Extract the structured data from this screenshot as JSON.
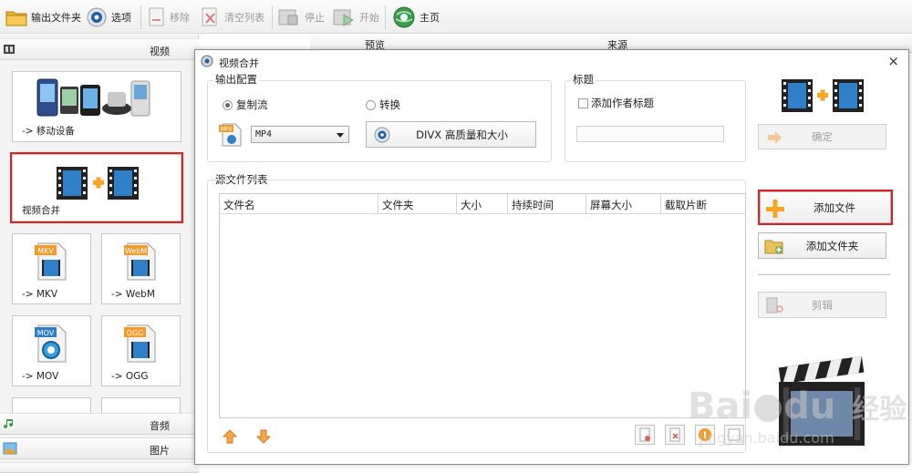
{
  "toolbar": {
    "output_folder": "输出文件夹",
    "options": "选项",
    "remove": "移除",
    "clear_list": "清空列表",
    "stop": "停止",
    "start": "开始",
    "home": "主页"
  },
  "left_panel": {
    "video_category": "视频",
    "tiles": {
      "mobile": "-> 移动设备",
      "merge": "视频合并",
      "mkv": "-> MKV",
      "webm": "-> WebM",
      "mov": "-> MOV",
      "ogg": "-> OGG"
    },
    "badges": {
      "mkv": "MKV",
      "webm": "WebM",
      "mov": "MOV",
      "ogg": "OGG"
    },
    "audio_category": "音频",
    "picture_category": "图片"
  },
  "main_header": {
    "preview": "预览",
    "source": "来源"
  },
  "dialog": {
    "title": "视频合并",
    "close": "×",
    "output_config": {
      "title": "输出配置",
      "copy_stream": "复制流",
      "convert": "转换",
      "format_value": "MP4",
      "format_badge": "MP4",
      "quality_button": "DIVX 高质量和大小"
    },
    "title_group": {
      "title": "标题",
      "add_author_title": "添加作者标题",
      "title_input": ""
    },
    "confirm_button": "确定",
    "source_list": {
      "title": "源文件列表",
      "columns": [
        "文件名",
        "文件夹",
        "大小",
        "持续时间",
        "屏幕大小",
        "截取片断"
      ]
    },
    "add_file_button": "添加文件",
    "add_folder_button": "添加文件夹",
    "edit_button": "剪辑"
  },
  "watermark": {
    "brand": "Bai",
    "brand_tail": "du",
    "subtitle": "经验",
    "url": "jingyan.baidu.com"
  },
  "colors": {
    "highlight": "#e02020",
    "accent_orange": "#f5a623",
    "film_blue": "#1e6fb8"
  }
}
